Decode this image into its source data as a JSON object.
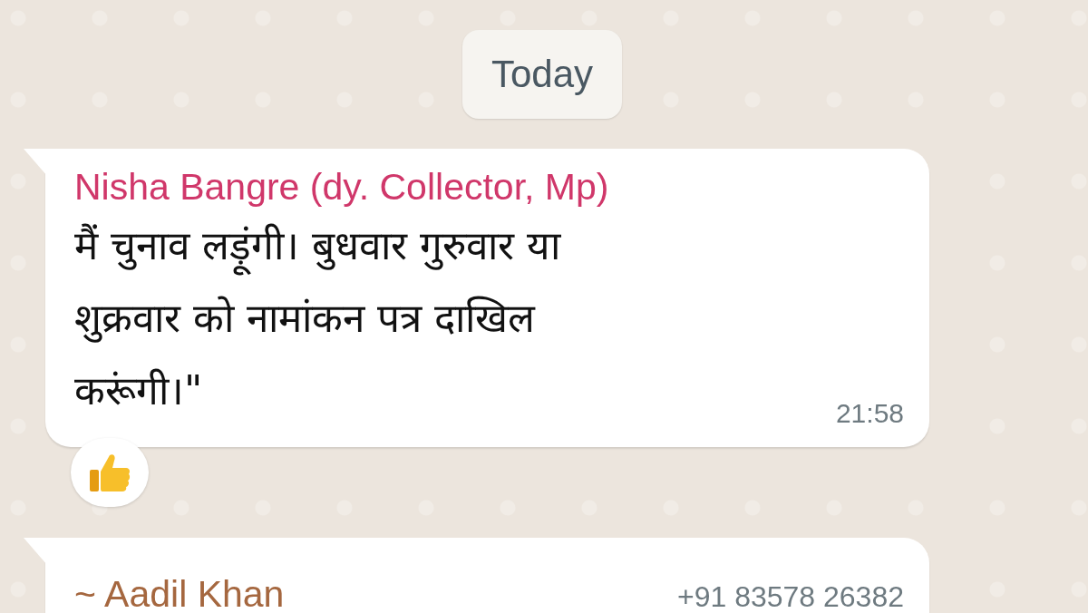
{
  "date_chip": "Today",
  "messages": [
    {
      "sender": "Nisha Bangre (dy. Collector, Mp)",
      "color": "#d0376a",
      "lines": [
        "मैं चुनाव लड़ूंगी। बुधवार गुरुवार या",
        "शुक्रवार को नामांकन पत्र दाखिल",
        "करूंगी।\""
      ],
      "time": "21:58",
      "reactions": [
        {
          "kind": "thumbs-up"
        }
      ]
    },
    {
      "sender": "~ Aadil Khan",
      "color": "#a5673f",
      "phone": "+91 83578 26382"
    }
  ]
}
